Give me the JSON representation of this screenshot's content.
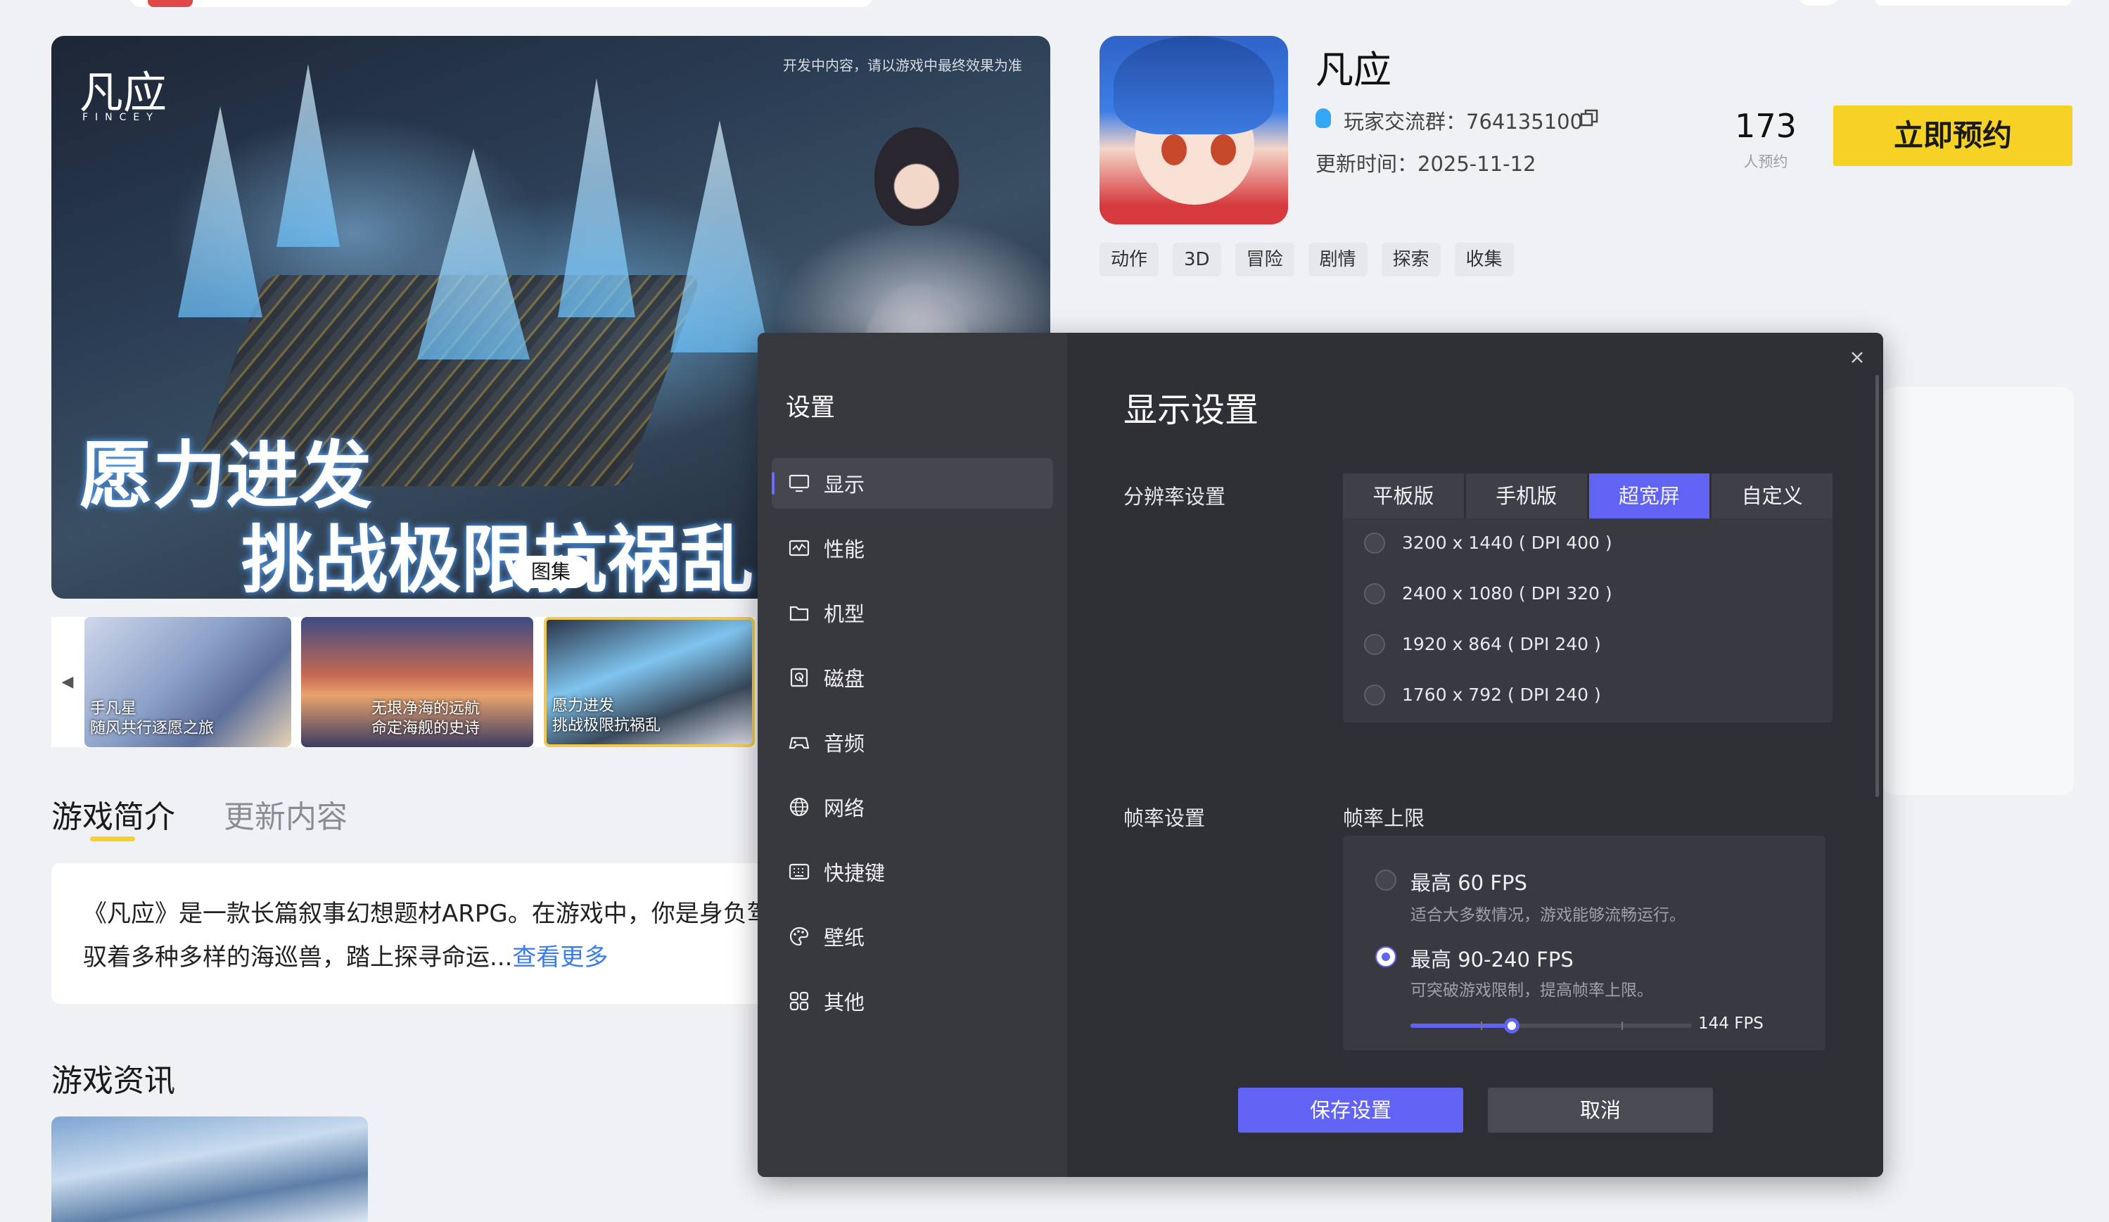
{
  "hero": {
    "logo": "凡应",
    "logo_sub": "FINCEY",
    "notice": "开发中内容，请以游戏中最终效果为准",
    "slogan_line1": "愿力进发",
    "slogan_line2": "挑战极限抗祸乱",
    "gallery_label": "图集"
  },
  "thumbnails": [
    {
      "caption_line1": "手凡星",
      "caption_line2": "随风共行逐愿之旅"
    },
    {
      "caption_line1": "无垠净海的远航",
      "caption_line2": "命定海舰的史诗"
    },
    {
      "caption_line1": "愿力进发",
      "caption_line2": "挑战极限抗祸乱"
    }
  ],
  "tabs": {
    "intro": "游戏简介",
    "update": "更新内容"
  },
  "intro": {
    "text": "《凡应》是一款长篇叙事幻想题材ARPG。在游戏中，你是身负驾驭着多种多样的海巡兽，踏上探寻命运...",
    "more": "查看更多"
  },
  "news": {
    "title": "游戏资讯"
  },
  "game": {
    "name": "凡应",
    "group": "玩家交流群：764135100",
    "update_time": "更新时间：2025-11-12",
    "reserve_count": "173",
    "reserve_label": "人预约",
    "reserve_button": "立即预约",
    "tags": [
      "动作",
      "3D",
      "冒险",
      "剧情",
      "探索",
      "收集"
    ]
  },
  "settings": {
    "title": "设置",
    "menu": [
      {
        "label": "显示",
        "icon": "monitor-icon",
        "active": true
      },
      {
        "label": "性能",
        "icon": "performance-icon",
        "active": false
      },
      {
        "label": "机型",
        "icon": "folder-icon",
        "active": false
      },
      {
        "label": "磁盘",
        "icon": "disk-icon",
        "active": false
      },
      {
        "label": "音频",
        "icon": "gamepad-icon",
        "active": false
      },
      {
        "label": "网络",
        "icon": "globe-icon",
        "active": false
      },
      {
        "label": "快捷键",
        "icon": "keyboard-icon",
        "active": false
      },
      {
        "label": "壁纸",
        "icon": "palette-icon",
        "active": false
      },
      {
        "label": "其他",
        "icon": "grid-icon",
        "active": false
      }
    ],
    "panel_title": "显示设置",
    "resolution_label": "分辨率设置",
    "resolution_tabs": [
      "平板版",
      "手机版",
      "超宽屏",
      "自定义"
    ],
    "resolution_active_tab": "超宽屏",
    "resolution_options": [
      "3200 x 1440 ( DPI 400 )",
      "2400 x 1080 ( DPI 320 )",
      "1920 x 864 ( DPI 240 )",
      "1760 x 792 ( DPI 240 )"
    ],
    "framerate_label": "帧率设置",
    "framerate_cap_label": "帧率上限",
    "fps_options": [
      {
        "title": "最高 60 FPS",
        "desc": "适合大多数情况，游戏能够流畅运行。",
        "checked": false
      },
      {
        "title": "最高 90-240 FPS",
        "desc": "可突破游戏限制，提高帧率上限。",
        "checked": true
      }
    ],
    "fps_slider": {
      "min": 90,
      "max": 240,
      "value": 144,
      "label": "144 FPS"
    },
    "save_button": "保存设置",
    "cancel_button": "取消"
  },
  "colors": {
    "accent": "#6163f5",
    "reserve": "#f5d224",
    "link": "#3b7de8"
  }
}
